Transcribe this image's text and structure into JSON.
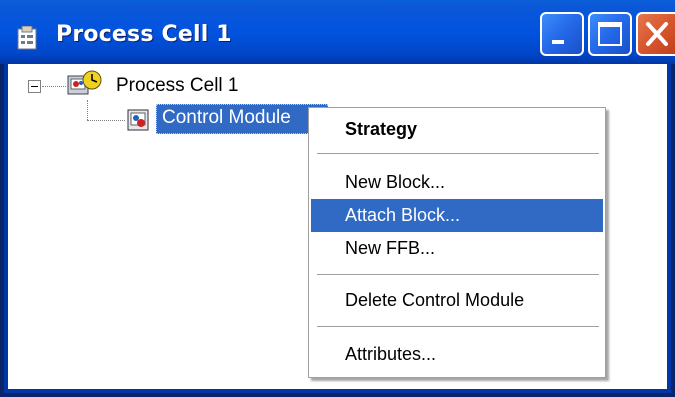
{
  "window": {
    "title": "Process Cell 1",
    "buttons": {
      "minimize": "minimize",
      "maximize": "maximize",
      "close": "close"
    }
  },
  "tree": {
    "root": {
      "label": "Process Cell 1",
      "icon": "process-cell-icon",
      "expanded": true
    },
    "child": {
      "label": "Control Module",
      "icon": "control-module-icon",
      "selected": true
    }
  },
  "context_menu": {
    "items": [
      {
        "label": "Strategy",
        "bold": true
      },
      {
        "separator": true
      },
      {
        "label": "New Block..."
      },
      {
        "label": "Attach Block...",
        "highlighted": true
      },
      {
        "label": "New FFB..."
      },
      {
        "separator": true
      },
      {
        "label": "Delete Control Module"
      },
      {
        "separator": true
      },
      {
        "label": "Attributes..."
      }
    ]
  },
  "colors": {
    "titlebar": "#0153df",
    "selection": "#316ac5",
    "close_button": "#d8562e"
  }
}
